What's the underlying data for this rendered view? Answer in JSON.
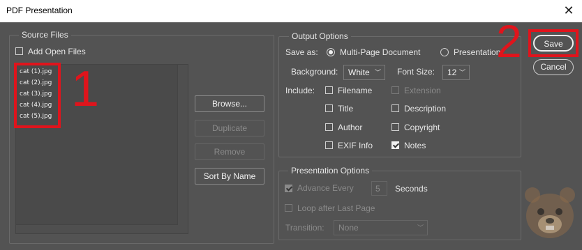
{
  "window": {
    "title": "PDF Presentation",
    "close_glyph": "✕"
  },
  "source_files": {
    "legend": "Source Files",
    "add_open_files_label": "Add Open Files",
    "add_open_files_checked": false,
    "files": [
      "cat (1).jpg",
      "cat (2).jpg",
      "cat (3).jpg",
      "cat (4).jpg",
      "cat (5).jpg"
    ],
    "buttons": {
      "browse": "Browse...",
      "duplicate": "Duplicate",
      "remove": "Remove",
      "sort_by_name": "Sort By Name"
    }
  },
  "output_options": {
    "legend": "Output Options",
    "save_as_label": "Save as:",
    "save_as_options": [
      "Multi-Page Document",
      "Presentation"
    ],
    "save_as_selected": "Multi-Page Document",
    "background_label": "Background:",
    "background_value": "White",
    "font_size_label": "Font Size:",
    "font_size_value": "12",
    "include_label": "Include:",
    "include": {
      "filename": {
        "label": "Filename",
        "checked": false
      },
      "extension": {
        "label": "Extension",
        "checked": false,
        "disabled": true
      },
      "title": {
        "label": "Title",
        "checked": false
      },
      "description": {
        "label": "Description",
        "checked": false
      },
      "author": {
        "label": "Author",
        "checked": false
      },
      "copyright": {
        "label": "Copyright",
        "checked": false
      },
      "exif_info": {
        "label": "EXIF Info",
        "checked": false
      },
      "notes": {
        "label": "Notes",
        "checked": true
      }
    }
  },
  "presentation_options": {
    "legend": "Presentation Options",
    "advance_every_label": "Advance Every",
    "advance_every_value": "5",
    "seconds_label": "Seconds",
    "loop_label": "Loop after Last Page",
    "transition_label": "Transition:",
    "transition_value": "None"
  },
  "actions": {
    "save": "Save",
    "cancel": "Cancel"
  },
  "annotations": {
    "marker_1": "1",
    "marker_2": "2",
    "color": "#e0141c"
  }
}
